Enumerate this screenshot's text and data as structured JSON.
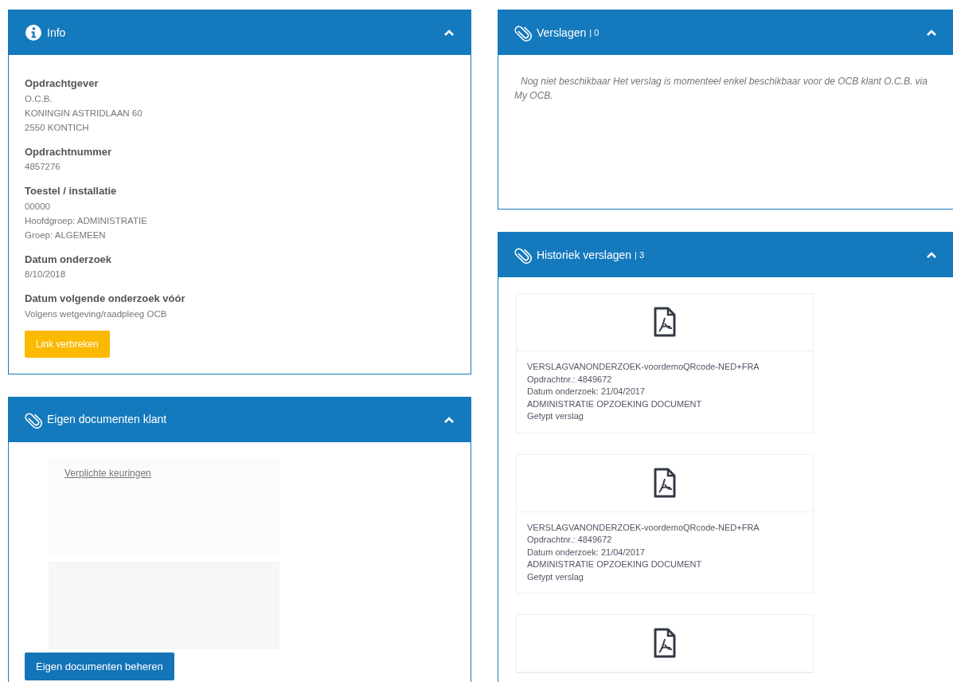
{
  "info_panel": {
    "title": "Info",
    "expanded": true,
    "fields": [
      {
        "label": "Opdrachtgever",
        "lines": [
          "O.C.B.",
          "KONINGIN ASTRIDLAAN 60",
          "2550 KONTICH"
        ]
      },
      {
        "label": "Opdrachtnummer",
        "lines": [
          "4857276"
        ]
      },
      {
        "label": "Toestel / installatie",
        "lines": [
          "00000",
          "Hoofdgroep: ADMINISTRATIE",
          "Groep: ALGEMEEN"
        ]
      },
      {
        "label": "Datum onderzoek",
        "lines": [
          "8/10/2018"
        ]
      },
      {
        "label": "Datum volgende onderzoek vóór",
        "lines": [
          "Volgens wetgeving/raadpleeg OCB"
        ]
      }
    ],
    "button": "Link verbreken"
  },
  "own_documents_panel": {
    "title": "Eigen documenten klant",
    "expanded": true,
    "link": "Verplichte keuringen",
    "button": "Eigen documenten beheren"
  },
  "reports_panel": {
    "title": "Verslagen",
    "count": "| 0",
    "expanded": true,
    "message": "Nog niet beschikbaar Het verslag is momenteel enkel beschikbaar voor de OCB klant O.C.B. via My OCB."
  },
  "history_panel": {
    "title": "Historiek verslagen",
    "count": "| 3",
    "expanded": true,
    "documents": [
      {
        "kind": "full",
        "lines": [
          "VERSLAGVANONDERZOEK-voordemoQRcode-NED+FRA",
          "Opdrachtnr.: 4849672",
          "Datum onderzoek: 21/04/2017",
          "ADMINISTRATIE OPZOEKING DOCUMENT",
          "Getypt verslag"
        ]
      },
      {
        "kind": "full",
        "lines": [
          "VERSLAGVANONDERZOEK-voordemoQRcode-NED+FRA",
          "Opdrachtnr.: 4849672",
          "Datum onderzoek: 21/04/2017",
          "ADMINISTRATIE OPZOEKING DOCUMENT",
          "Getypt verslag"
        ]
      },
      {
        "kind": "partial"
      }
    ]
  }
}
